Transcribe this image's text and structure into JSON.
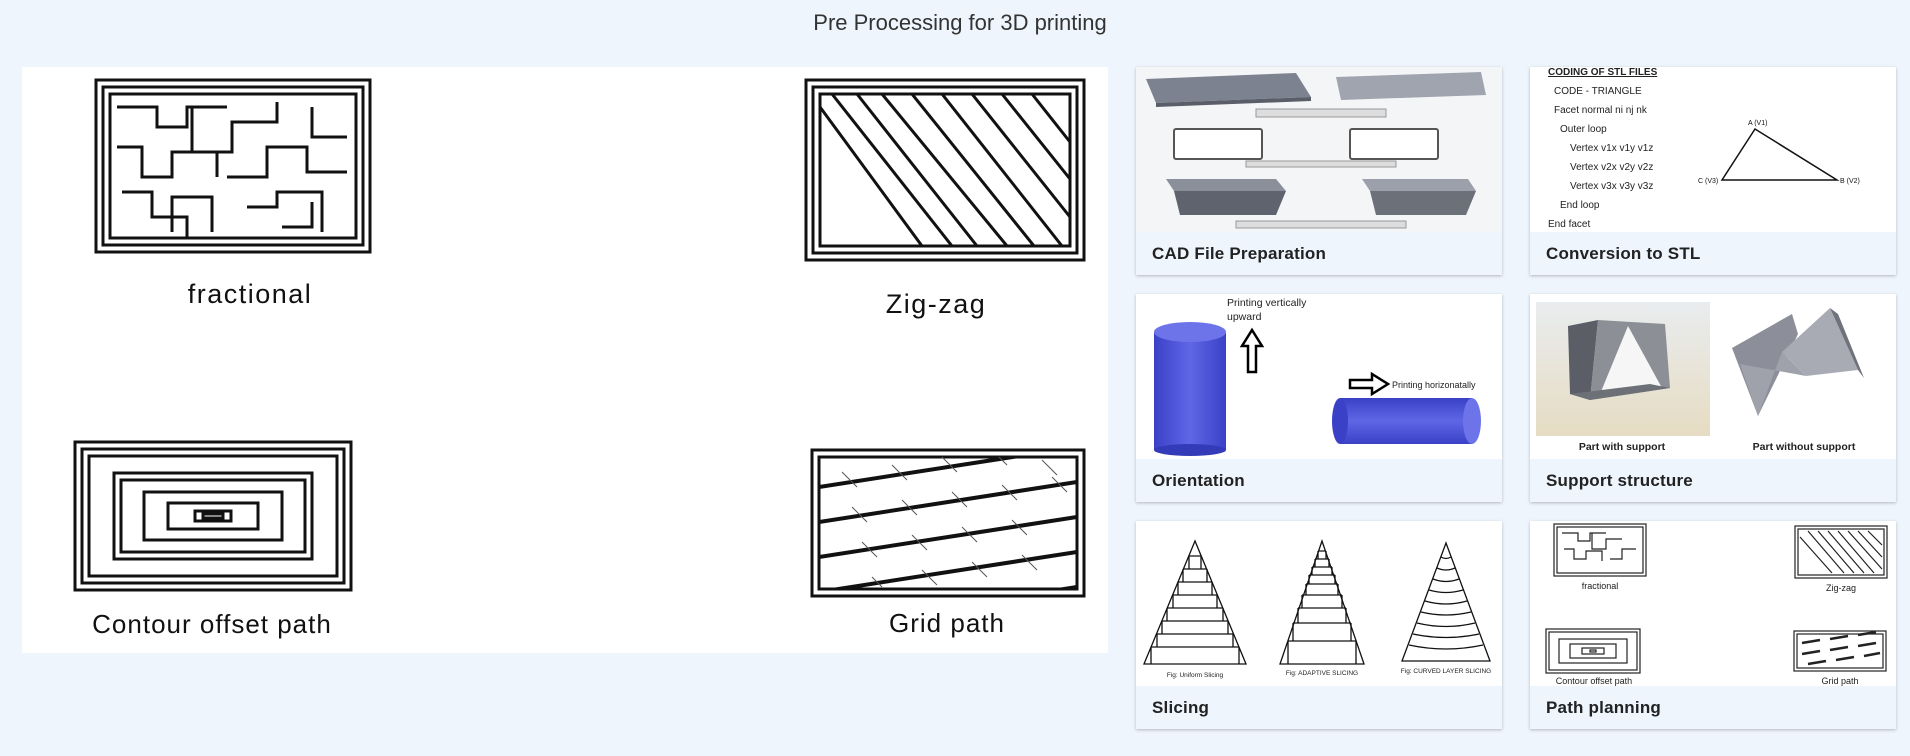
{
  "page": {
    "title": "Pre Processing for 3D printing"
  },
  "main_view": {
    "labels": {
      "fractional": "fractional",
      "zigzag": "Zig-zag",
      "contour": "Contour offset path",
      "grid": "Grid path"
    }
  },
  "cards": [
    {
      "caption": "CAD File Preparation"
    },
    {
      "caption": "Conversion to STL"
    },
    {
      "caption": "Orientation"
    },
    {
      "caption": "Support structure"
    },
    {
      "caption": "Slicing"
    },
    {
      "caption": "Path planning"
    }
  ],
  "stl": {
    "heading": "CODING OF STL FILES",
    "lines": [
      "CODE - TRIANGLE",
      "Facet normal  ni nj nk",
      "Outer loop",
      "Vertex v1x v1y v1z",
      "Vertex v2x v2y v2z",
      "Vertex v3x v3y v3z",
      "End loop",
      "End facet"
    ],
    "vertices": [
      "A (V1)",
      "B (V2)",
      "C (V3)"
    ]
  },
  "orientation": {
    "vertical": "Printing vertically upward",
    "vertical_line1": "Printing vertically",
    "vertical_line2": "upward",
    "horizontal": "Printing horizonatally"
  },
  "support": {
    "with": "Part with support",
    "without": "Part without support"
  },
  "slicing": {
    "uniform": "Fig: Uniform Slicing",
    "adaptive": "Fig: ADAPTIVE SLICING",
    "curved": "Fig: CURVED LAYER SLICING"
  },
  "colors": {
    "background": "#eef5fd",
    "caption_bg": "#eef5fd",
    "cylinder": "#4a52d8"
  }
}
